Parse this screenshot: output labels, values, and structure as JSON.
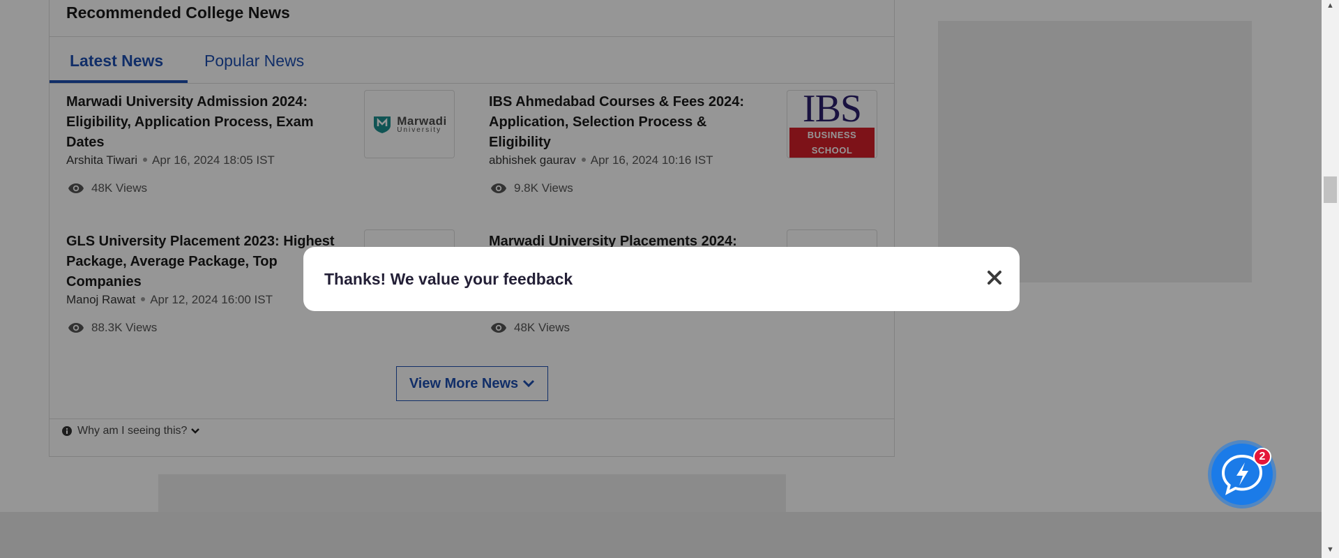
{
  "section": {
    "title": "Recommended College News",
    "tabs": [
      {
        "label": "Latest News",
        "active": true
      },
      {
        "label": "Popular News",
        "active": false
      }
    ]
  },
  "news": [
    {
      "title": "Marwadi University Admission 2024: Eligibility, Application Process, Exam Dates",
      "author": "Arshita Tiwari",
      "date": "Apr 16, 2024 18:05 IST",
      "views": "48K Views",
      "thumb_text": "Marwadi",
      "thumb_subtext": "University"
    },
    {
      "title": "IBS Ahmedabad Courses & Fees 2024: Application, Selection Process & Eligibility",
      "author": "abhishek gaurav",
      "date": "Apr 16, 2024 10:16 IST",
      "views": "9.8K Views",
      "thumb_text": "IBS",
      "thumb_subtext": "BUSINESS SCHOOL"
    },
    {
      "title": "GLS University Placement 2023: Highest Package, Average Package, Top Companies",
      "author": "Manoj Rawat",
      "date": "Apr 12, 2024 16:00 IST",
      "views": "88.3K Views"
    },
    {
      "title": "Marwadi University Placements 2024:",
      "views": "48K Views"
    }
  ],
  "view_more_label": "View More News",
  "why_label": "Why am I seeing this?",
  "modal": {
    "message": "Thanks! We value your feedback"
  },
  "chat": {
    "badge_count": "2"
  },
  "colors": {
    "accent": "#1d4fb1",
    "badge": "#e4163a",
    "chat_blue": "#1b7be8"
  }
}
